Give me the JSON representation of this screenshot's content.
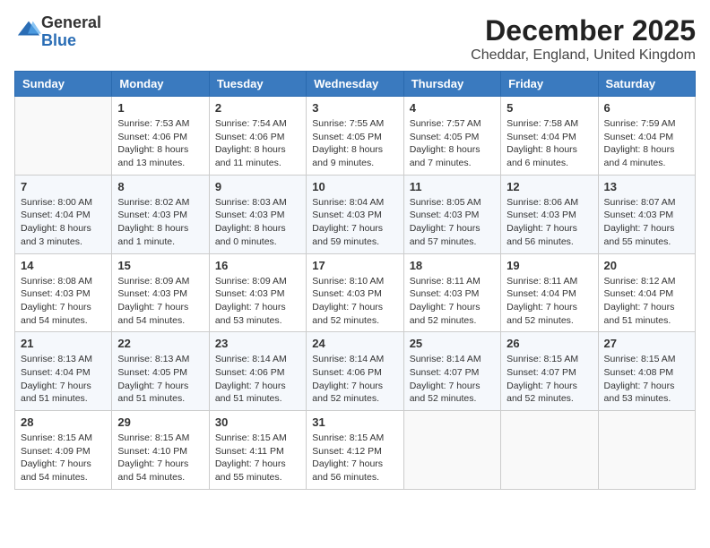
{
  "logo": {
    "general": "General",
    "blue": "Blue"
  },
  "title": "December 2025",
  "subtitle": "Cheddar, England, United Kingdom",
  "days_of_week": [
    "Sunday",
    "Monday",
    "Tuesday",
    "Wednesday",
    "Thursday",
    "Friday",
    "Saturday"
  ],
  "weeks": [
    [
      {
        "day": "",
        "info": ""
      },
      {
        "day": "1",
        "info": "Sunrise: 7:53 AM\nSunset: 4:06 PM\nDaylight: 8 hours\nand 13 minutes."
      },
      {
        "day": "2",
        "info": "Sunrise: 7:54 AM\nSunset: 4:06 PM\nDaylight: 8 hours\nand 11 minutes."
      },
      {
        "day": "3",
        "info": "Sunrise: 7:55 AM\nSunset: 4:05 PM\nDaylight: 8 hours\nand 9 minutes."
      },
      {
        "day": "4",
        "info": "Sunrise: 7:57 AM\nSunset: 4:05 PM\nDaylight: 8 hours\nand 7 minutes."
      },
      {
        "day": "5",
        "info": "Sunrise: 7:58 AM\nSunset: 4:04 PM\nDaylight: 8 hours\nand 6 minutes."
      },
      {
        "day": "6",
        "info": "Sunrise: 7:59 AM\nSunset: 4:04 PM\nDaylight: 8 hours\nand 4 minutes."
      }
    ],
    [
      {
        "day": "7",
        "info": "Sunrise: 8:00 AM\nSunset: 4:04 PM\nDaylight: 8 hours\nand 3 minutes."
      },
      {
        "day": "8",
        "info": "Sunrise: 8:02 AM\nSunset: 4:03 PM\nDaylight: 8 hours\nand 1 minute."
      },
      {
        "day": "9",
        "info": "Sunrise: 8:03 AM\nSunset: 4:03 PM\nDaylight: 8 hours\nand 0 minutes."
      },
      {
        "day": "10",
        "info": "Sunrise: 8:04 AM\nSunset: 4:03 PM\nDaylight: 7 hours\nand 59 minutes."
      },
      {
        "day": "11",
        "info": "Sunrise: 8:05 AM\nSunset: 4:03 PM\nDaylight: 7 hours\nand 57 minutes."
      },
      {
        "day": "12",
        "info": "Sunrise: 8:06 AM\nSunset: 4:03 PM\nDaylight: 7 hours\nand 56 minutes."
      },
      {
        "day": "13",
        "info": "Sunrise: 8:07 AM\nSunset: 4:03 PM\nDaylight: 7 hours\nand 55 minutes."
      }
    ],
    [
      {
        "day": "14",
        "info": "Sunrise: 8:08 AM\nSunset: 4:03 PM\nDaylight: 7 hours\nand 54 minutes."
      },
      {
        "day": "15",
        "info": "Sunrise: 8:09 AM\nSunset: 4:03 PM\nDaylight: 7 hours\nand 54 minutes."
      },
      {
        "day": "16",
        "info": "Sunrise: 8:09 AM\nSunset: 4:03 PM\nDaylight: 7 hours\nand 53 minutes."
      },
      {
        "day": "17",
        "info": "Sunrise: 8:10 AM\nSunset: 4:03 PM\nDaylight: 7 hours\nand 52 minutes."
      },
      {
        "day": "18",
        "info": "Sunrise: 8:11 AM\nSunset: 4:03 PM\nDaylight: 7 hours\nand 52 minutes."
      },
      {
        "day": "19",
        "info": "Sunrise: 8:11 AM\nSunset: 4:04 PM\nDaylight: 7 hours\nand 52 minutes."
      },
      {
        "day": "20",
        "info": "Sunrise: 8:12 AM\nSunset: 4:04 PM\nDaylight: 7 hours\nand 51 minutes."
      }
    ],
    [
      {
        "day": "21",
        "info": "Sunrise: 8:13 AM\nSunset: 4:04 PM\nDaylight: 7 hours\nand 51 minutes."
      },
      {
        "day": "22",
        "info": "Sunrise: 8:13 AM\nSunset: 4:05 PM\nDaylight: 7 hours\nand 51 minutes."
      },
      {
        "day": "23",
        "info": "Sunrise: 8:14 AM\nSunset: 4:06 PM\nDaylight: 7 hours\nand 51 minutes."
      },
      {
        "day": "24",
        "info": "Sunrise: 8:14 AM\nSunset: 4:06 PM\nDaylight: 7 hours\nand 52 minutes."
      },
      {
        "day": "25",
        "info": "Sunrise: 8:14 AM\nSunset: 4:07 PM\nDaylight: 7 hours\nand 52 minutes."
      },
      {
        "day": "26",
        "info": "Sunrise: 8:15 AM\nSunset: 4:07 PM\nDaylight: 7 hours\nand 52 minutes."
      },
      {
        "day": "27",
        "info": "Sunrise: 8:15 AM\nSunset: 4:08 PM\nDaylight: 7 hours\nand 53 minutes."
      }
    ],
    [
      {
        "day": "28",
        "info": "Sunrise: 8:15 AM\nSunset: 4:09 PM\nDaylight: 7 hours\nand 54 minutes."
      },
      {
        "day": "29",
        "info": "Sunrise: 8:15 AM\nSunset: 4:10 PM\nDaylight: 7 hours\nand 54 minutes."
      },
      {
        "day": "30",
        "info": "Sunrise: 8:15 AM\nSunset: 4:11 PM\nDaylight: 7 hours\nand 55 minutes."
      },
      {
        "day": "31",
        "info": "Sunrise: 8:15 AM\nSunset: 4:12 PM\nDaylight: 7 hours\nand 56 minutes."
      },
      {
        "day": "",
        "info": ""
      },
      {
        "day": "",
        "info": ""
      },
      {
        "day": "",
        "info": ""
      }
    ]
  ]
}
